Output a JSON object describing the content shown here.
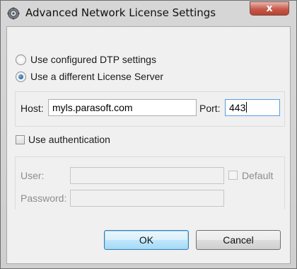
{
  "window": {
    "title": "Advanced Network License Settings",
    "close_glyph": "x"
  },
  "options": {
    "dtp_label": "Use configured DTP settings",
    "dtp_selected": false,
    "server_label": "Use a different License Server",
    "server_selected": true
  },
  "server": {
    "host_label": "Host:",
    "host_value": "myls.parasoft.com",
    "port_label": "Port:",
    "port_value": "443"
  },
  "auth": {
    "checkbox_label": "Use authentication",
    "checked": false,
    "user_label": "User:",
    "user_value": "",
    "default_label": "Default",
    "password_label": "Password:",
    "password_value": ""
  },
  "buttons": {
    "ok": "OK",
    "cancel": "Cancel"
  },
  "colors": {
    "accent": "#3c7fb1",
    "close": "#c75a4a",
    "dialog_bg": "#f0f0f0"
  },
  "icons": {
    "app": "gear-icon"
  }
}
